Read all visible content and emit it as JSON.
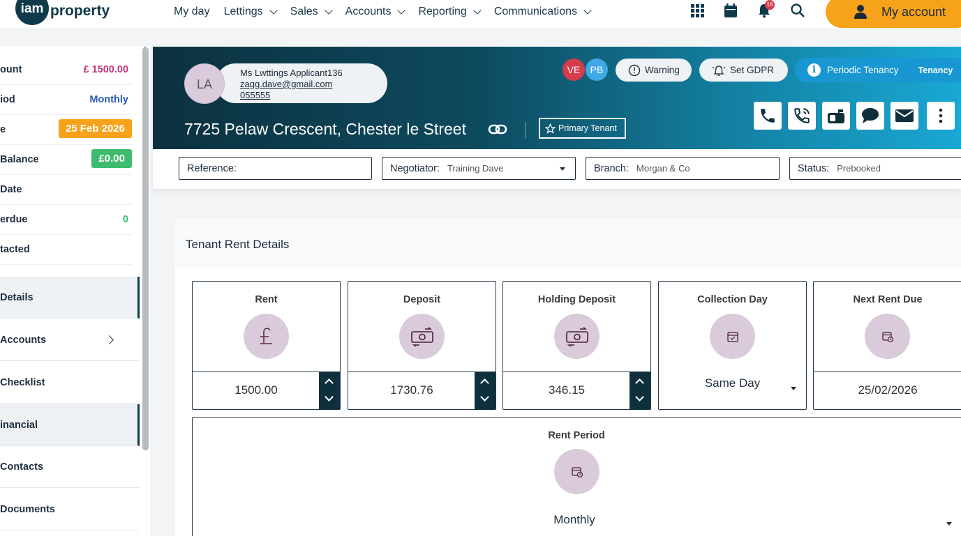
{
  "brand": {
    "logo_short": "iam",
    "logo_word": "property"
  },
  "nav": {
    "items": [
      {
        "label": "My day",
        "chevron": false
      },
      {
        "label": "Lettings",
        "chevron": true
      },
      {
        "label": "Sales",
        "chevron": true
      },
      {
        "label": "Accounts",
        "chevron": true
      },
      {
        "label": "Reporting",
        "chevron": true
      },
      {
        "label": "Communications",
        "chevron": true
      }
    ],
    "notification_count": "16",
    "account_label": "My account",
    "accent_color": "#f7a21b"
  },
  "sidebar": {
    "summary": [
      {
        "label": "ount",
        "value": "£ 1500.00",
        "color": "#c0397e"
      },
      {
        "label": "iod",
        "value": "Monthly",
        "color": "#2a5db0"
      },
      {
        "label": "e",
        "value": "25 Feb 2026",
        "pill": "#f7a21b",
        "color": "#ffffff"
      },
      {
        "label": " Balance",
        "value": "£0.00",
        "pill": "#3dbb6e",
        "color": "#ffffff"
      },
      {
        "label": " Date",
        "value": ""
      },
      {
        "label": "erdue",
        "value": "0",
        "color": "#3dbb6e"
      },
      {
        "label": "tacted",
        "value": ""
      }
    ],
    "menu": [
      {
        "label": "Details",
        "active": true,
        "arrow": false
      },
      {
        "label": "Accounts",
        "active": false,
        "arrow": true
      },
      {
        "label": "Checklist",
        "active": false,
        "arrow": false
      },
      {
        "label": "inancial",
        "active": true,
        "arrow": false
      },
      {
        "label": "Contacts",
        "active": false,
        "arrow": false
      },
      {
        "label": "Documents",
        "active": false,
        "arrow": false
      }
    ]
  },
  "header": {
    "avatar_initials": "LA",
    "contact_name": "Ms Lwttings Applicant136",
    "contact_email": "zagg.dave@gmail.com",
    "contact_phone": "055555",
    "address": "7725 Pelaw Crescent, Chester le Street",
    "primary_tenant_label": "Primary Tenant",
    "user_initials": [
      {
        "initials": "VE",
        "color": "#d63c4b"
      },
      {
        "initials": "PB",
        "color": "#3fa9e6"
      }
    ],
    "warning_label": "Warning",
    "gdpr_label": "Set GDPR",
    "tenancy_label": "Periodic Tenancy",
    "tenancy_short": "Tenancy"
  },
  "filters": {
    "reference_label": "Reference:",
    "reference_value": "",
    "negotiator_label": "Negotiator:",
    "negotiator_value": "Training Dave",
    "branch_label": "Branch:",
    "branch_value": "Morgan & Co",
    "status_label": "Status:",
    "status_value": "Prebooked"
  },
  "rent": {
    "section_title": "Tenant Rent Details",
    "rent_label": "Rent",
    "rent_value": "1500.00",
    "deposit_label": "Deposit",
    "deposit_value": "1730.76",
    "holding_label": "Holding Deposit",
    "holding_value": "346.15",
    "collection_label": "Collection Day",
    "collection_value": "Same Day",
    "next_due_label": "Next Rent Due",
    "next_due_value": "25/02/2026",
    "period_label": "Rent Period",
    "period_value": "Monthly"
  }
}
